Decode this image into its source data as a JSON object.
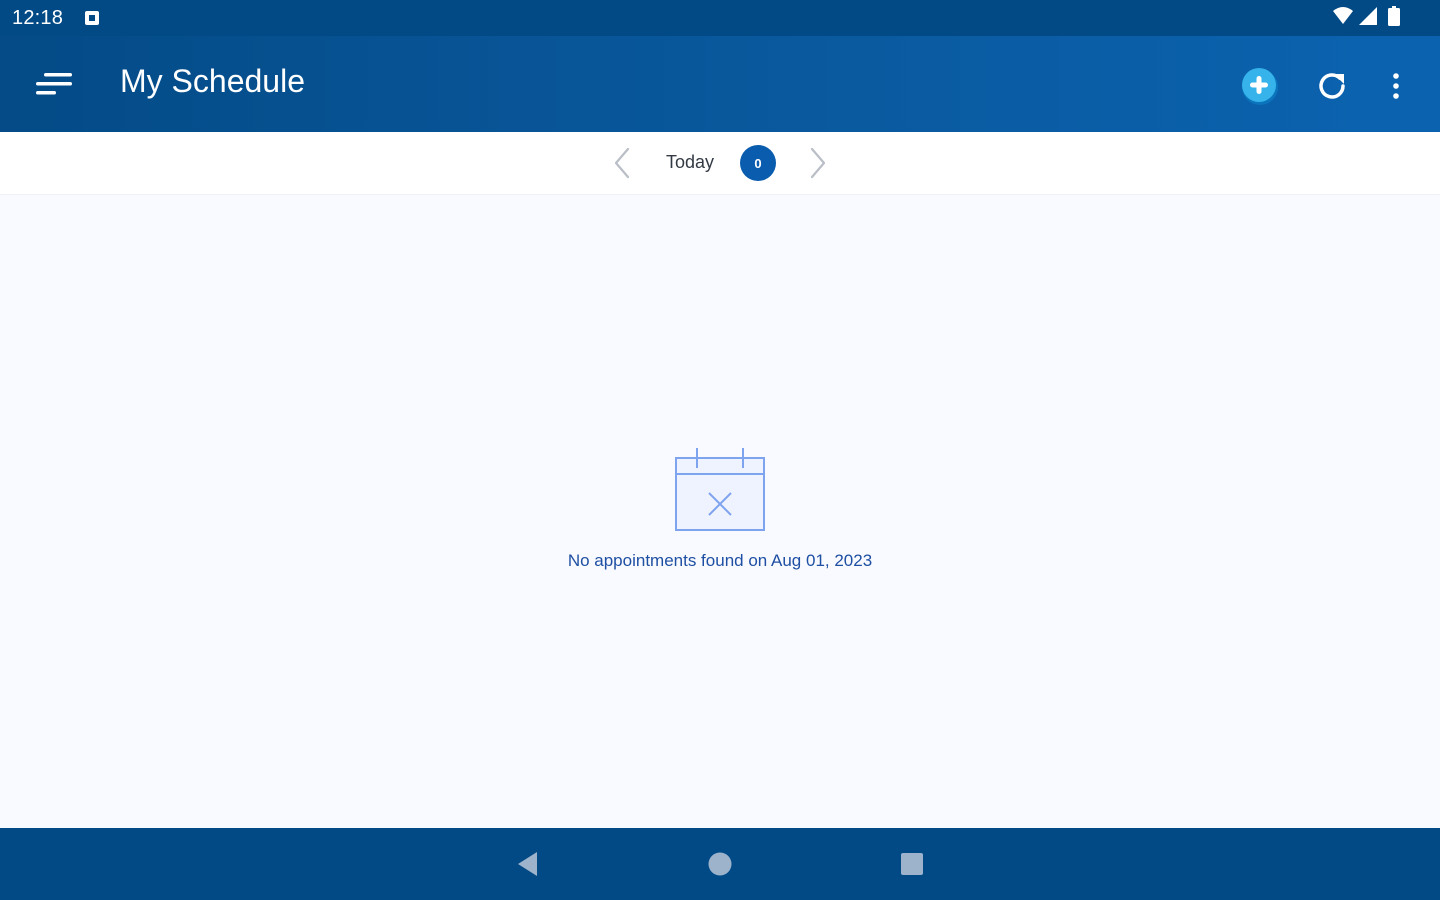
{
  "status_bar": {
    "time": "12:18",
    "notification_icon": "square-notification-icon",
    "wifi_icon": "wifi-icon",
    "signal_icon": "cell-signal-icon",
    "battery_icon": "battery-icon"
  },
  "app_bar": {
    "title": "My Schedule",
    "menu_icon": "menu-icon",
    "add_icon": "add-circle-icon",
    "refresh_icon": "refresh-icon",
    "more_icon": "more-vert-icon"
  },
  "date_nav": {
    "label": "Today",
    "count": "0"
  },
  "empty_state": {
    "icon": "calendar-cancel-icon",
    "message": "No appointments found on Aug 01, 2023"
  },
  "colors": {
    "primary": "#024a85",
    "accent": "#0a5cae",
    "add_button": "#35b3ea",
    "empty_text": "#1f4fa3",
    "background": "#f8faff"
  }
}
